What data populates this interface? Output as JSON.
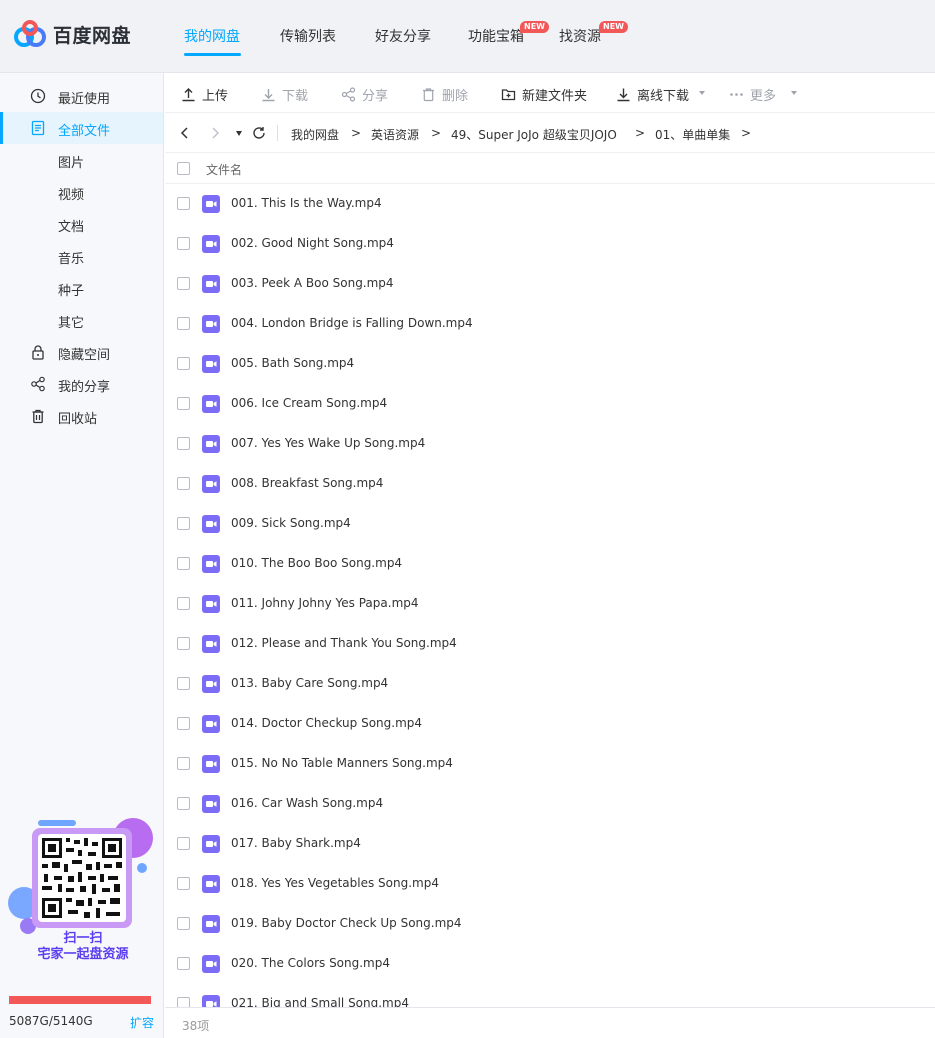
{
  "app": {
    "title": "百度网盘"
  },
  "nav": [
    {
      "label": "我的网盘",
      "active": true
    },
    {
      "label": "传输列表"
    },
    {
      "label": "好友分享"
    },
    {
      "label": "功能宝箱",
      "badge": "NEW"
    },
    {
      "label": "找资源",
      "badge": "NEW"
    }
  ],
  "sidebar": {
    "items": [
      {
        "label": "最近使用",
        "icon": "clock-icon"
      },
      {
        "label": "全部文件",
        "icon": "file-icon",
        "active": true
      },
      {
        "label": "图片"
      },
      {
        "label": "视频"
      },
      {
        "label": "文档"
      },
      {
        "label": "音乐"
      },
      {
        "label": "种子"
      },
      {
        "label": "其它"
      },
      {
        "label": "隐藏空间",
        "icon": "lock-icon"
      },
      {
        "label": "我的分享",
        "icon": "share-icon"
      },
      {
        "label": "回收站",
        "icon": "trash-icon"
      }
    ],
    "promo_line1": "扫一扫",
    "promo_line2": "宅家一起盘资源",
    "storage": "5087G/5140G",
    "storage_used_fraction": 0.99,
    "expand": "扩容"
  },
  "toolbar": {
    "upload": "上传",
    "download": "下载",
    "share": "分享",
    "delete": "删除",
    "new_folder": "新建文件夹",
    "offline_download": "离线下载",
    "more": "更多"
  },
  "breadcrumb": [
    "我的网盘",
    "英语资源",
    "49、Super JoJo 超级宝贝JOJO",
    "01、单曲单集"
  ],
  "list": {
    "header": "文件名",
    "files": [
      "001. This Is the Way.mp4",
      "002. Good Night Song.mp4",
      "003. Peek A Boo Song.mp4",
      "004. London Bridge is Falling Down.mp4",
      "005. Bath Song.mp4",
      "006. Ice Cream Song.mp4",
      "007. Yes Yes Wake Up Song.mp4",
      "008. Breakfast Song.mp4",
      "009. Sick Song.mp4",
      "010. The Boo Boo Song.mp4",
      "011. Johny Johny Yes Papa.mp4",
      "012. Please and Thank You Song.mp4",
      "013. Baby Care Song.mp4",
      "014. Doctor Checkup Song.mp4",
      "015. No No Table Manners Song.mp4",
      "016. Car Wash Song.mp4",
      "017. Baby Shark.mp4",
      "018. Yes Yes Vegetables Song.mp4",
      "019. Baby Doctor Check Up Song.mp4",
      "020. The Colors Song.mp4",
      "021. Big and Small Song.mp4"
    ]
  },
  "footer": {
    "count": "38项"
  },
  "colors": {
    "accent": "#06a7ff",
    "badge": "#f25858",
    "video_icon": "#7b6cf6"
  }
}
